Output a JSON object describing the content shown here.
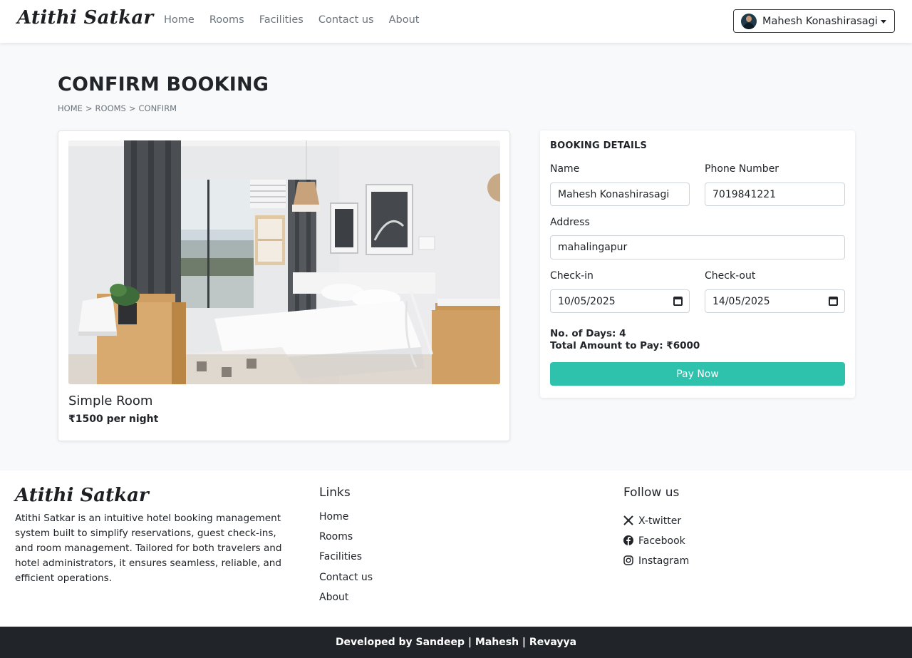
{
  "nav": {
    "brand": "Atithi Satkar",
    "links": [
      "Home",
      "Rooms",
      "Facilities",
      "Contact us",
      "About"
    ],
    "user_name": "Mahesh Konashirasagi"
  },
  "page": {
    "title": "CONFIRM BOOKING",
    "breadcrumb": [
      "HOME",
      ">",
      "ROOMS",
      ">",
      "CONFIRM"
    ]
  },
  "room": {
    "name": "Simple Room",
    "price": "₹1500 per night"
  },
  "booking": {
    "title": "BOOKING DETAILS",
    "name_label": "Name",
    "name_value": "Mahesh Konashirasagi",
    "phone_label": "Phone Number",
    "phone_value": "7019841221",
    "address_label": "Address",
    "address_value": "mahalingapur",
    "checkin_label": "Check-in",
    "checkin_value": "10/05/2025",
    "checkout_label": "Check-out",
    "checkout_value": "14/05/2025",
    "days_text": "No. of Days: 4",
    "total_text": "Total Amount to Pay: ₹6000",
    "pay_label": "Pay Now"
  },
  "footer": {
    "brand": "Atithi Satkar",
    "description": "Atithi Satkar is an intuitive hotel booking management system built to simplify reservations, guest check-ins, and room management. Tailored for both travelers and hotel administrators, it ensures seamless, reliable, and efficient operations.",
    "links_heading": "Links",
    "links": [
      "Home",
      "Rooms",
      "Facilities",
      "Contact us",
      "About"
    ],
    "follow_heading": "Follow us",
    "social": [
      {
        "icon": "x-twitter-icon",
        "label": "X-twitter"
      },
      {
        "icon": "facebook-icon",
        "label": "Facebook"
      },
      {
        "icon": "instagram-icon",
        "label": "Instagram"
      }
    ],
    "credits": "Developed by Sandeep | Mahesh | Revayya"
  },
  "colors": {
    "accent": "#2ec1ac",
    "dark": "#212529"
  }
}
